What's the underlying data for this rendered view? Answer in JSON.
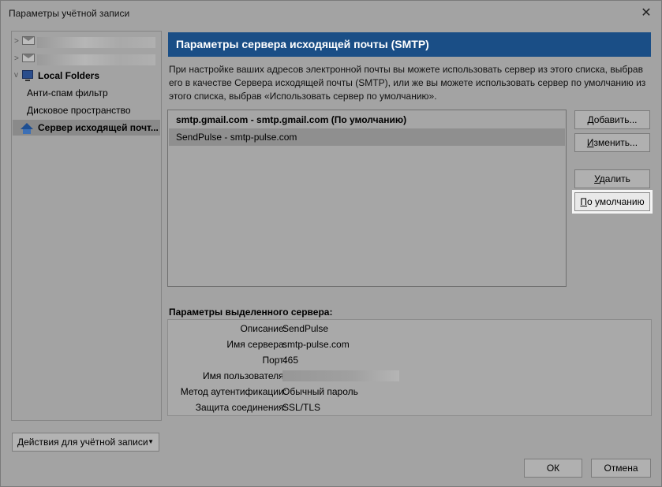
{
  "window": {
    "title": "Параметры учётной записи",
    "close_glyph": "✕"
  },
  "tree": {
    "items": [
      {
        "type": "account",
        "arrow": ">"
      },
      {
        "type": "account",
        "arrow": ">"
      },
      {
        "type": "local",
        "arrow": "v",
        "label": "Local Folders"
      },
      {
        "type": "child",
        "label": "Анти-спам фильтр"
      },
      {
        "type": "child",
        "label": "Дисковое пространство"
      },
      {
        "type": "smtp",
        "label": "Сервер исходящей почт..."
      }
    ]
  },
  "account_actions": {
    "label": "Действия для учётной записи",
    "caret": "▼"
  },
  "panel": {
    "header": "Параметры сервера исходящей почты (SMTP)",
    "description": "При настройке ваших адресов электронной почты вы можете использовать сервер из этого списка, выбрав его в качестве Сервера исходящей почты (SMTP), или же вы можете использовать сервер по умолчанию из этого списка, выбрав «Использовать сервер по умолчанию»."
  },
  "servers": [
    {
      "label": "smtp.gmail.com - smtp.gmail.com (По умолчанию)"
    },
    {
      "label": "SendPulse - smtp-pulse.com"
    }
  ],
  "buttons": {
    "add": {
      "pre": "",
      "u": "Д",
      "post": "обавить..."
    },
    "edit": {
      "pre": "",
      "u": "И",
      "post": "зменить..."
    },
    "delete": {
      "pre": "",
      "u": "У",
      "post": "далить"
    },
    "default": {
      "pre": "",
      "u": "П",
      "post": "о умолчанию"
    },
    "ok": "ОК",
    "cancel": "Отмена"
  },
  "details": {
    "title": "Параметры выделенного сервера:",
    "rows": [
      {
        "key": "Описание:",
        "value": "SendPulse"
      },
      {
        "key": "Имя сервера:",
        "value": "smtp-pulse.com"
      },
      {
        "key": "Порт:",
        "value": "465"
      },
      {
        "key": "Имя пользователя:",
        "value": ""
      },
      {
        "key": "Метод аутентификации:",
        "value": "Обычный пароль"
      },
      {
        "key": "Защита соединения:",
        "value": "SSL/TLS"
      }
    ]
  }
}
